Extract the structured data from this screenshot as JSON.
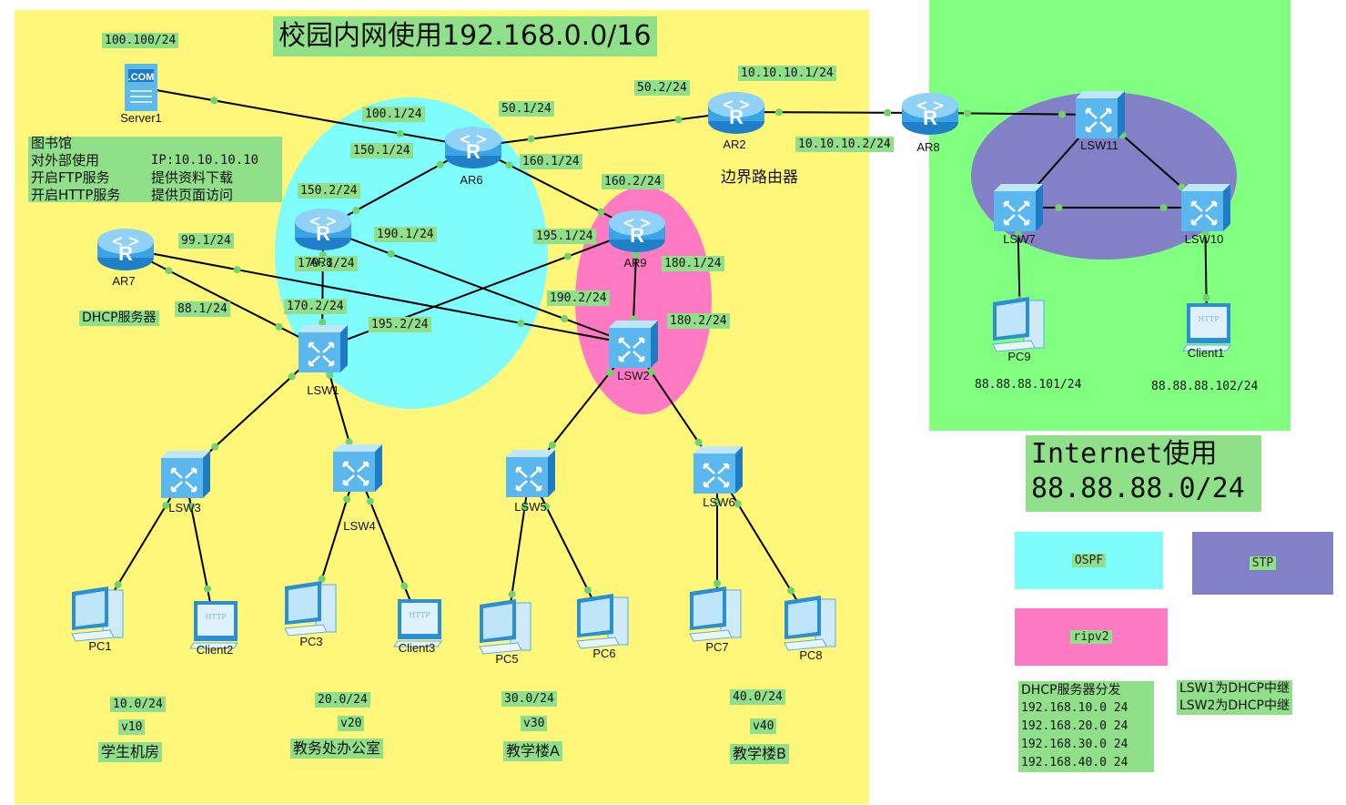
{
  "title": "校园内网使用192.168.0.0/16",
  "internet_title": "Internet使用",
  "internet_subnet": "88.88.88.0/24",
  "colors": {
    "campus_bg": "#fff77a",
    "internet_bg": "#80ff80",
    "ospf": "#7ffcfc",
    "ripv2": "#ff7ac3",
    "stp": "#8280c7",
    "label_bg": "#8fe088",
    "link": "#000000",
    "port": "#6fd36f"
  },
  "library_note": {
    "lines": [
      "图书馆",
      "对外部使用",
      "开启FTP服务",
      "开启HTTP服务"
    ],
    "right_lines": [
      "IP:10.10.10.10",
      "提供资料下载",
      "提供页面访问"
    ]
  },
  "devices": [
    {
      "id": "Server1",
      "label": "Server1",
      "icon": "server-icon"
    },
    {
      "id": "AR6",
      "label": "AR6",
      "icon": "router-icon"
    },
    {
      "id": "AR2",
      "label": "AR2",
      "icon": "router-icon"
    },
    {
      "id": "AR8_edge",
      "label": "AR8",
      "icon": "router-icon"
    },
    {
      "id": "AR8_campus",
      "label": "AR8",
      "icon": "router-icon"
    },
    {
      "id": "AR7",
      "label": "AR7",
      "icon": "router-icon"
    },
    {
      "id": "AR9",
      "label": "AR9",
      "icon": "router-icon"
    },
    {
      "id": "LSW1",
      "label": "LSW1",
      "icon": "switch-icon"
    },
    {
      "id": "LSW2",
      "label": "LSW2",
      "icon": "switch-icon"
    },
    {
      "id": "LSW3",
      "label": "LSW3",
      "icon": "switch-icon"
    },
    {
      "id": "LSW4",
      "label": "LSW4",
      "icon": "switch-icon"
    },
    {
      "id": "LSW5",
      "label": "LSW5",
      "icon": "switch-icon"
    },
    {
      "id": "LSW6",
      "label": "LSW6",
      "icon": "switch-icon"
    },
    {
      "id": "LSW11",
      "label": "LSW11",
      "icon": "switch-icon"
    },
    {
      "id": "LSW7",
      "label": "LSW7",
      "icon": "switch-icon"
    },
    {
      "id": "LSW10",
      "label": "LSW10",
      "icon": "switch-icon"
    },
    {
      "id": "PC1",
      "label": "PC1",
      "icon": "pc-icon"
    },
    {
      "id": "Client2",
      "label": "Client2",
      "icon": "http-client-icon"
    },
    {
      "id": "PC3",
      "label": "PC3",
      "icon": "pc-icon"
    },
    {
      "id": "Client3",
      "label": "Client3",
      "icon": "http-client-icon"
    },
    {
      "id": "PC5",
      "label": "PC5",
      "icon": "pc-icon"
    },
    {
      "id": "PC6",
      "label": "PC6",
      "icon": "pc-icon"
    },
    {
      "id": "PC7",
      "label": "PC7",
      "icon": "pc-icon"
    },
    {
      "id": "PC8",
      "label": "PC8",
      "icon": "pc-icon"
    },
    {
      "id": "PC9",
      "label": "PC9",
      "icon": "pc-icon"
    },
    {
      "id": "Client1",
      "label": "Client1",
      "icon": "http-client-icon"
    }
  ],
  "links": [
    [
      "Server1",
      "AR6"
    ],
    [
      "AR6",
      "AR2"
    ],
    [
      "AR2",
      "AR8_edge"
    ],
    [
      "AR8_edge",
      "LSW11"
    ],
    [
      "LSW11",
      "LSW7"
    ],
    [
      "LSW11",
      "LSW10"
    ],
    [
      "LSW7",
      "LSW10"
    ],
    [
      "LSW7",
      "PC9"
    ],
    [
      "LSW10",
      "Client1"
    ],
    [
      "AR6",
      "AR8_campus"
    ],
    [
      "AR6",
      "AR9"
    ],
    [
      "AR8_campus",
      "LSW1"
    ],
    [
      "AR8_campus",
      "LSW2"
    ],
    [
      "AR9",
      "LSW1"
    ],
    [
      "AR9",
      "LSW2"
    ],
    [
      "AR7",
      "LSW1"
    ],
    [
      "AR7",
      "LSW2"
    ],
    [
      "LSW1",
      "LSW3"
    ],
    [
      "LSW1",
      "LSW4"
    ],
    [
      "LSW2",
      "LSW5"
    ],
    [
      "LSW2",
      "LSW6"
    ],
    [
      "LSW3",
      "PC1"
    ],
    [
      "LSW3",
      "Client2"
    ],
    [
      "LSW4",
      "PC3"
    ],
    [
      "LSW4",
      "Client3"
    ],
    [
      "LSW5",
      "PC5"
    ],
    [
      "LSW5",
      "PC6"
    ],
    [
      "LSW6",
      "PC7"
    ],
    [
      "LSW6",
      "PC8"
    ]
  ],
  "ip_labels": [
    {
      "id": "server1-ip",
      "text": "100.100/24"
    },
    {
      "id": "ar6-100",
      "text": "100.1/24"
    },
    {
      "id": "ar6-50",
      "text": "50.1/24"
    },
    {
      "id": "ar2-50",
      "text": "50.2/24"
    },
    {
      "id": "ar2-10",
      "text": "10.10.10.1/24"
    },
    {
      "id": "ar8-10",
      "text": "10.10.10.2/24"
    },
    {
      "id": "ar6-150",
      "text": "150.1/24"
    },
    {
      "id": "ar6-160",
      "text": "160.1/24"
    },
    {
      "id": "ar8c-150",
      "text": "150.2/24"
    },
    {
      "id": "ar9-160",
      "text": "160.2/24"
    },
    {
      "id": "ar7-99",
      "text": "99.1/24"
    },
    {
      "id": "ar8c-190",
      "text": "190.1/24"
    },
    {
      "id": "ar9-195",
      "text": "195.1/24"
    },
    {
      "id": "ar8c-170",
      "text": "170.1/24"
    },
    {
      "id": "ar9-180",
      "text": "180.1/24"
    },
    {
      "id": "ar7-88",
      "text": "88.1/24"
    },
    {
      "id": "lsw1-170",
      "text": "170.2/24"
    },
    {
      "id": "lsw1-195",
      "text": "195.2/24"
    },
    {
      "id": "lsw2-190",
      "text": "190.2/24"
    },
    {
      "id": "lsw2-180",
      "text": "180.2/24"
    },
    {
      "id": "pc9-ip",
      "text": "88.88.88.101/24"
    },
    {
      "id": "client1-ip",
      "text": "88.88.88.102/24"
    }
  ],
  "ar2_role": "边界路由器",
  "ar7_role": "DHCP服务器",
  "vlans": [
    {
      "subnet": "10.0/24",
      "vlan": "v10",
      "name": "学生机房"
    },
    {
      "subnet": "20.0/24",
      "vlan": "v20",
      "name": "教务处办公室"
    },
    {
      "subnet": "30.0/24",
      "vlan": "v30",
      "name": "教学楼A"
    },
    {
      "subnet": "40.0/24",
      "vlan": "v40",
      "name": "教学楼B"
    }
  ],
  "legend": {
    "ospf": "OSPF",
    "stp": "STP",
    "ripv2": "ripv2"
  },
  "dhcp_note": {
    "title": "DHCP服务器分发",
    "pools": [
      "192.168.10.0 24",
      "192.168.20.0 24",
      "192.168.30.0 24",
      "192.168.40.0 24"
    ]
  },
  "relay_note": [
    "LSW1为DHCP中继",
    "LSW2为DHCP中继"
  ]
}
